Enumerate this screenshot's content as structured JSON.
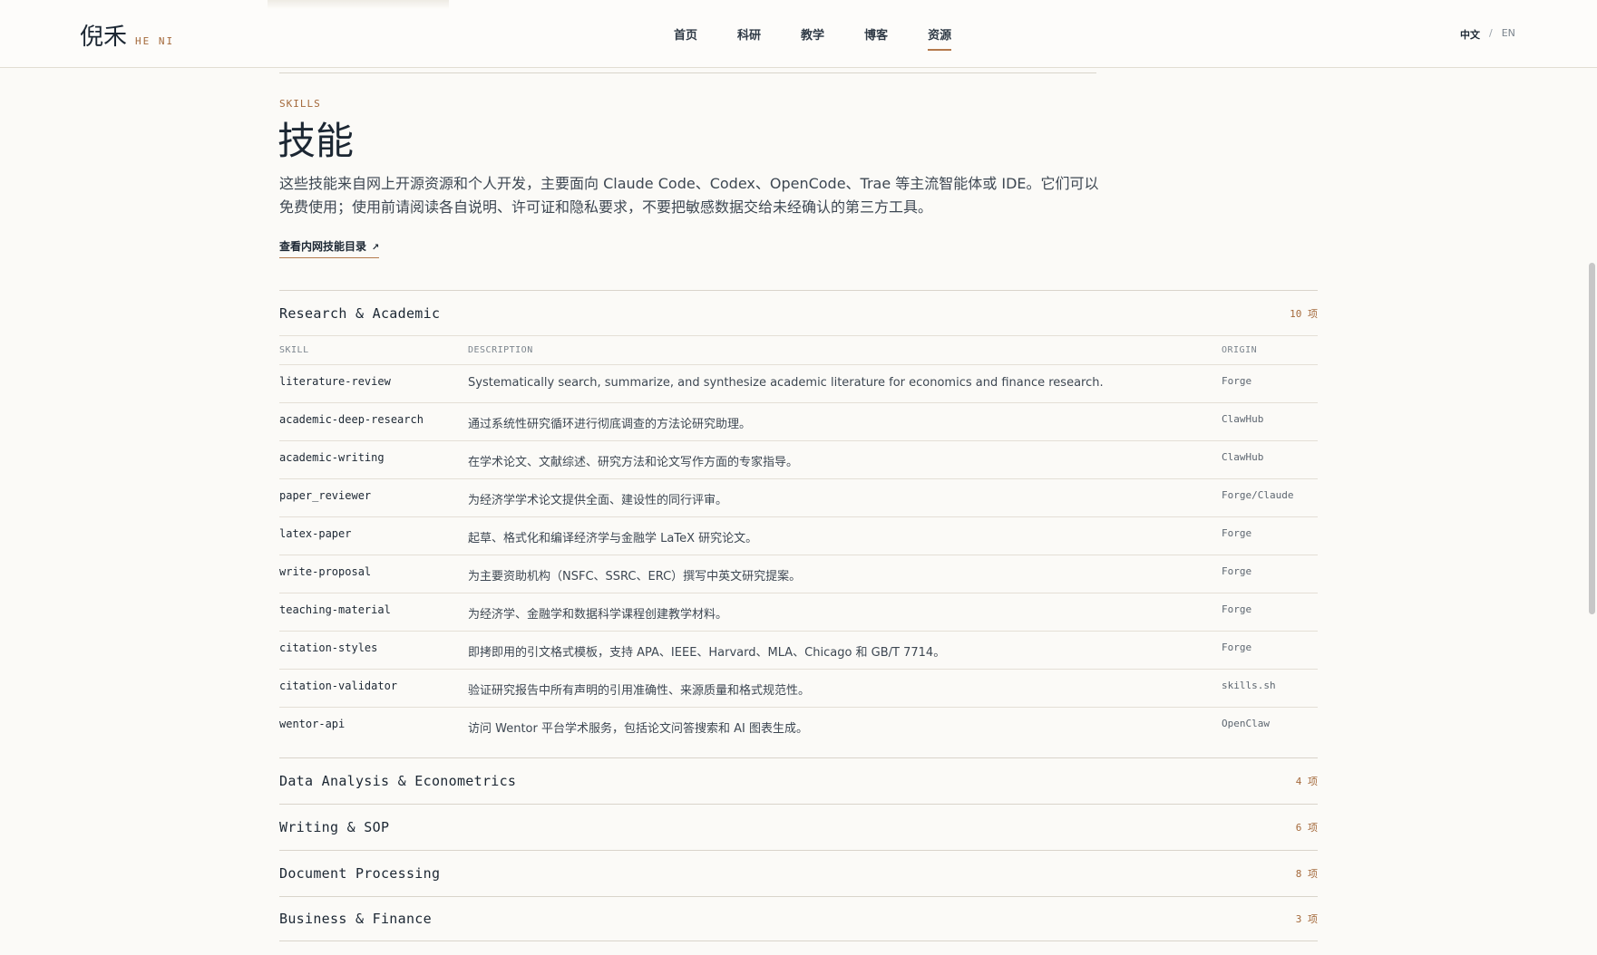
{
  "header": {
    "logo_cn": "倪禾",
    "logo_en": "HE NI",
    "nav": [
      "首页",
      "科研",
      "教学",
      "博客",
      "资源"
    ],
    "active_nav": "资源",
    "lang_current": "中文",
    "lang_sep": "/",
    "lang_other": "EN"
  },
  "page": {
    "eyebrow": "SKILLS",
    "title": "技能",
    "intro": "这些技能来自网上开源资源和个人开发，主要面向 Claude Code、Codex、OpenCode、Trae 等主流智能体或 IDE。它们可以免费使用；使用前请阅读各自说明、许可证和隐私要求，不要把敏感数据交给未经确认的第三方工具。",
    "catalog_link": "查看内网技能目录",
    "catalog_arrow": "↗"
  },
  "table_headers": {
    "skill": "SKILL",
    "description": "DESCRIPTION",
    "origin": "ORIGIN"
  },
  "sections": [
    {
      "title": "Research & Academic",
      "count": "10 项",
      "expanded": true,
      "rows": [
        {
          "skill": "literature-review",
          "desc": "Systematically search, summarize, and synthesize academic literature for economics and finance research.",
          "origin": "Forge"
        },
        {
          "skill": "academic-deep-research",
          "desc": "通过系统性研究循环进行彻底调查的方法论研究助理。",
          "origin": "ClawHub"
        },
        {
          "skill": "academic-writing",
          "desc": "在学术论文、文献综述、研究方法和论文写作方面的专家指导。",
          "origin": "ClawHub"
        },
        {
          "skill": "paper_reviewer",
          "desc": "为经济学学术论文提供全面、建设性的同行评审。",
          "origin": "Forge/Claude"
        },
        {
          "skill": "latex-paper",
          "desc": "起草、格式化和编译经济学与金融学 LaTeX 研究论文。",
          "origin": "Forge"
        },
        {
          "skill": "write-proposal",
          "desc": "为主要资助机构（NSFC、SSRC、ERC）撰写中英文研究提案。",
          "origin": "Forge"
        },
        {
          "skill": "teaching-material",
          "desc": "为经济学、金融学和数据科学课程创建教学材料。",
          "origin": "Forge"
        },
        {
          "skill": "citation-styles",
          "desc": "即拷即用的引文格式模板，支持 APA、IEEE、Harvard、MLA、Chicago 和 GB/T 7714。",
          "origin": "Forge"
        },
        {
          "skill": "citation-validator",
          "desc": "验证研究报告中所有声明的引用准确性、来源质量和格式规范性。",
          "origin": "skills.sh"
        },
        {
          "skill": "wentor-api",
          "desc": "访问 Wentor 平台学术服务，包括论文问答搜索和 AI 图表生成。",
          "origin": "OpenClaw"
        }
      ]
    },
    {
      "title": "Data Analysis & Econometrics",
      "count": "4 项",
      "expanded": false
    },
    {
      "title": "Writing & SOP",
      "count": "6 项",
      "expanded": false
    },
    {
      "title": "Document Processing",
      "count": "8 项",
      "expanded": false
    },
    {
      "title": "Business & Finance",
      "count": "3 项",
      "expanded": false
    }
  ],
  "colors": {
    "accent": "#b47a4c",
    "text": "#1c2733",
    "background": "#fbfaf7"
  }
}
